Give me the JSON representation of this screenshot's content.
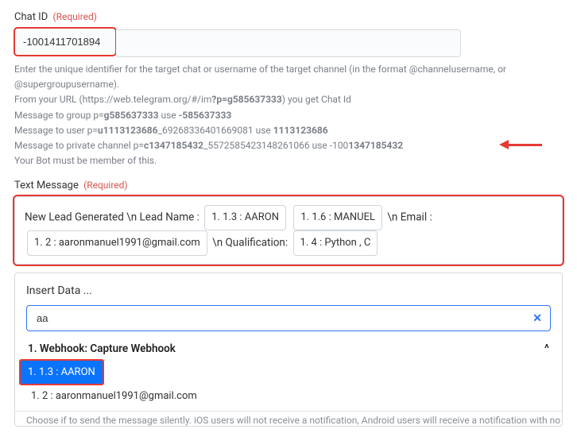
{
  "chatId": {
    "label": "Chat ID",
    "required": "(Required)",
    "value": "-1001411701894",
    "help1": "Enter the unique identifier for the target chat or username of the target channel (in the format @channelusername, or @supergroupusername).",
    "help2_a": "From your URL (https://web.telegram.org/#/im",
    "help2_b": "?p=g585637333",
    "help2_c": ") you get Chat Id",
    "help3_a": "Message to group p=",
    "help3_b": "g585637333",
    "help3_c": " use ",
    "help3_d": "-585637333",
    "help4_a": "Message to user p=",
    "help4_b": "u1113123686",
    "help4_c": "_69268336401669081 use ",
    "help4_d": "1113123686",
    "help5_a": "Message to private channel p=",
    "help5_b": "c1347185432",
    "help5_c": "_5572585423148261066 use -100",
    "help5_d": "1347185432",
    "help6": "Your Bot must be member of this."
  },
  "textMessage": {
    "label": "Text Message",
    "required": "(Required)",
    "text1": "New Lead Generated \\n Lead Name : ",
    "chip1": "1. 1.3 : AARON",
    "chip2": "1. 1.6 : MANUEL",
    "text2": " \\n Email : ",
    "chip3": "1. 2 : aaronmanuel1991@gmail.com",
    "text3": " \\n Qualification: ",
    "chip4": "1. 4 : Python , C"
  },
  "insert": {
    "title": "Insert Data ...",
    "searchValue": "aa",
    "webhookTitle": "1. Webhook: Capture Webhook",
    "selected": "1. 1.3 : AARON",
    "item2": "1. 2 : aaronmanuel1991@gmail.com"
  },
  "cutoff": "Choose if to send the message silently. iOS users will not receive a notification, Android users will receive a notification with no sound."
}
